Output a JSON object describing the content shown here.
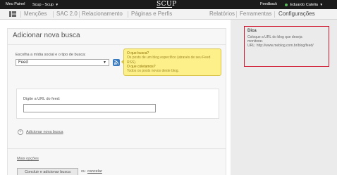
{
  "topbar": {
    "menu_label": "Meu Painel",
    "account_label": "Scup - Scup",
    "logo": "SCUP",
    "feedback_label": "Feedback",
    "user_label": "Eduardo Catelia"
  },
  "nav": {
    "items": [
      {
        "label": "Menções"
      },
      {
        "label": "SAC 2.0"
      },
      {
        "label": "Relacionamento"
      },
      {
        "label": "Páginas e Perfis"
      }
    ],
    "right_items": [
      {
        "label": "Relatórios"
      },
      {
        "label": "Ferramentas"
      },
      {
        "label": "Configurações"
      }
    ]
  },
  "main": {
    "title": "Adicionar nova busca",
    "select_label": "Escolha a mídia social e o tipo de busca:",
    "select_value": "Feed",
    "tip": {
      "q1": "O que busca?",
      "a1": "Os posts de um blog específico (através de seu Feed",
      "a1b": "RSS).",
      "q2": "O que coletamos?",
      "a2": "Todos os posts novos deste blog."
    },
    "url_label": "Digite a URL do feed:",
    "url_value": "",
    "add_link": "Adicionar nova busca",
    "more_options": "Mais opções",
    "submit_label": "Concluir e adicionar busca",
    "or_text": "ou",
    "cancel_label": "cancelar"
  },
  "hint": {
    "title": "Dica",
    "line1": "Coloque a URL do blog que deseja",
    "line2": "monitorar.",
    "line3": "URL: http://www.meblog.com.br/blog/feed/"
  },
  "colors": {
    "topbar_bg": "#1b1b1b",
    "accent_blue": "#3a7bbf",
    "tip_yellow": "#fdf08a",
    "hint_border": "#d0142b"
  }
}
